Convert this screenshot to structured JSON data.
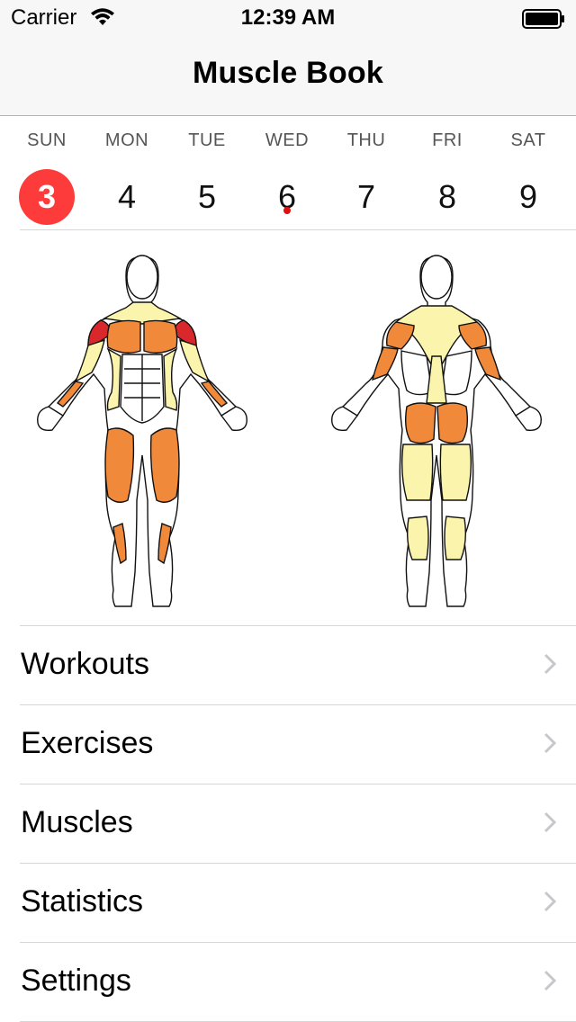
{
  "status": {
    "carrier": "Carrier",
    "time": "12:39 AM"
  },
  "nav": {
    "title": "Muscle Book"
  },
  "week": {
    "days": [
      {
        "name": "SUN",
        "num": "3",
        "selected": true,
        "dot": false
      },
      {
        "name": "MON",
        "num": "4",
        "selected": false,
        "dot": false
      },
      {
        "name": "TUE",
        "num": "5",
        "selected": false,
        "dot": false
      },
      {
        "name": "WED",
        "num": "6",
        "selected": false,
        "dot": true
      },
      {
        "name": "THU",
        "num": "7",
        "selected": false,
        "dot": false
      },
      {
        "name": "FRI",
        "num": "8",
        "selected": false,
        "dot": false
      },
      {
        "name": "SAT",
        "num": "9",
        "selected": false,
        "dot": false
      }
    ]
  },
  "colors": {
    "accent_red": "#fe3b3b",
    "muscle_orange": "#f08a3a",
    "muscle_red": "#d9282b",
    "muscle_yellow": "#fbf4ad"
  },
  "menu": {
    "items": [
      {
        "label": "Workouts"
      },
      {
        "label": "Exercises"
      },
      {
        "label": "Muscles"
      },
      {
        "label": "Statistics"
      },
      {
        "label": "Settings"
      }
    ]
  }
}
